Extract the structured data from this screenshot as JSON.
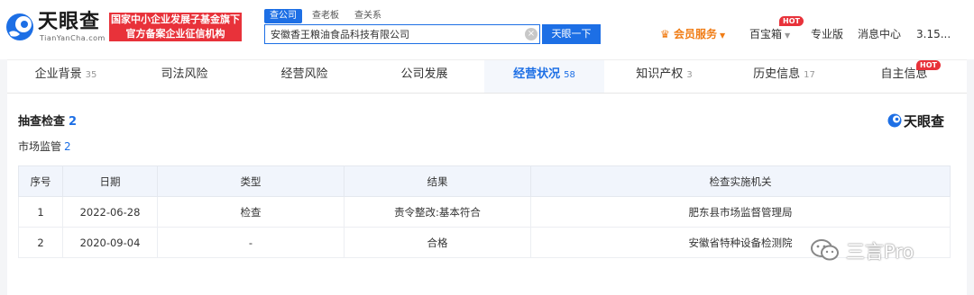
{
  "header": {
    "logo_text": "天眼查",
    "logo_domain": "TianYanCha.com",
    "promo_line1": "国家中小企业发展子基金旗下",
    "promo_line2": "官方备案企业征信机构",
    "search_tabs": [
      "查公司",
      "查老板",
      "查关系"
    ],
    "search_value": "安徽香王粮油食品科技有限公司",
    "search_button": "天眼一下",
    "vip": "会员服务",
    "treasure": "百宝箱",
    "hot": "HOT",
    "pro": "专业版",
    "messages": "消息中心",
    "user": "3.15..."
  },
  "tabs": [
    {
      "label": "企业背景",
      "count": "35"
    },
    {
      "label": "司法风险",
      "count": ""
    },
    {
      "label": "经营风险",
      "count": ""
    },
    {
      "label": "公司发展",
      "count": ""
    },
    {
      "label": "经营状况",
      "count": "58"
    },
    {
      "label": "知识产权",
      "count": "3"
    },
    {
      "label": "历史信息",
      "count": "17"
    },
    {
      "label": "自主信息",
      "count": ""
    }
  ],
  "section": {
    "title": "抽查检查",
    "count": "2",
    "subtitle": "市场监管",
    "sub_count": "2",
    "brand": "天眼查"
  },
  "table": {
    "headers": [
      "序号",
      "日期",
      "类型",
      "结果",
      "检查实施机关"
    ],
    "rows": [
      [
        "1",
        "2022-06-28",
        "检查",
        "责令整改:基本符合",
        "肥东县市场监督管理局"
      ],
      [
        "2",
        "2020-09-04",
        "-",
        "合格",
        "安徽省特种设备检测院"
      ]
    ]
  },
  "watermark": "三言Pro",
  "colors": {
    "accent": "#1d6fe5",
    "promo": "#e8323a",
    "vip": "#f07d16"
  }
}
